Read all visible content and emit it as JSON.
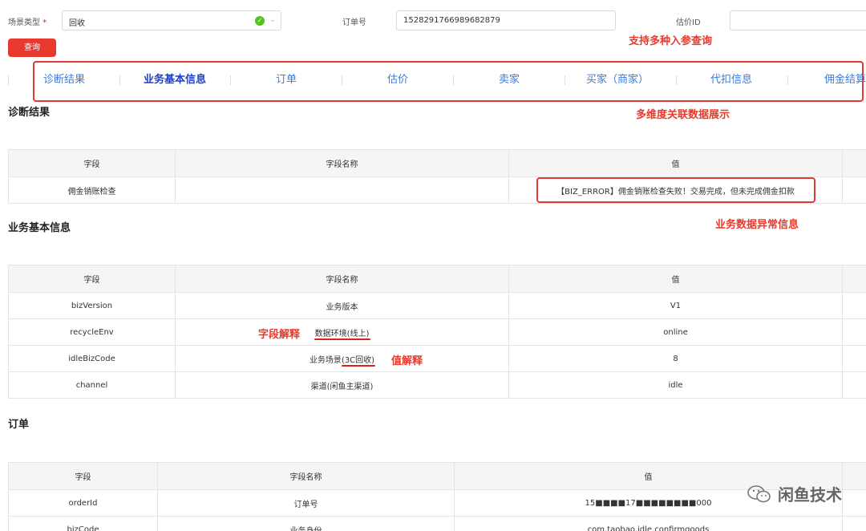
{
  "form": {
    "scene_label": "场景类型",
    "required_mark": "*",
    "scene_value": "回收",
    "order_label": "订单号",
    "order_value": "1528291766989682879",
    "estimate_label": "估价ID",
    "estimate_value": "",
    "query_label": "查询"
  },
  "annotations": {
    "multi_input": "支持多种入参查询",
    "multi_dim": "多维度关联数据展示",
    "biz_error": "业务数据异常信息",
    "field_explain": "字段解释",
    "value_explain": "值解释"
  },
  "tabs": [
    "诊断结果",
    "业务基本信息",
    "订单",
    "估价",
    "卖家",
    "买家（商家）",
    "代扣信息",
    "佣金结算"
  ],
  "sections": {
    "diagnosis": {
      "title": "诊断结果",
      "headers": [
        "字段",
        "字段名称",
        "值"
      ],
      "rows": [
        [
          "佣金销账检查",
          "",
          "【BIZ_ERROR】佣金销账检查失败！交易完成，但未完成佣金扣款"
        ]
      ]
    },
    "basic": {
      "title": "业务基本信息",
      "headers": [
        "字段",
        "字段名称",
        "值"
      ],
      "rows": [
        [
          "bizVersion",
          "业务版本",
          "V1"
        ],
        [
          "recycleEnv",
          "数据环境(线上)",
          "online"
        ],
        [
          "idleBizCode",
          "业务场景(3C回收)",
          "8"
        ],
        [
          "channel",
          "渠道(闲鱼主渠道)",
          "idle"
        ]
      ]
    },
    "order": {
      "title": "订单",
      "headers": [
        "字段",
        "字段名称",
        "值"
      ],
      "rows": [
        [
          "orderId",
          "订单号",
          "15■■■■17■■■■■■■■000"
        ],
        [
          "bizCode",
          "业务身份",
          "com.taobao.idle.confirmgoods"
        ]
      ]
    }
  },
  "watermark": "闲鱼技术",
  "colors": {
    "accent": "#e8392f",
    "tab": "#3a7be0",
    "tab_active": "#1b3fc9",
    "success": "#52c41a"
  }
}
